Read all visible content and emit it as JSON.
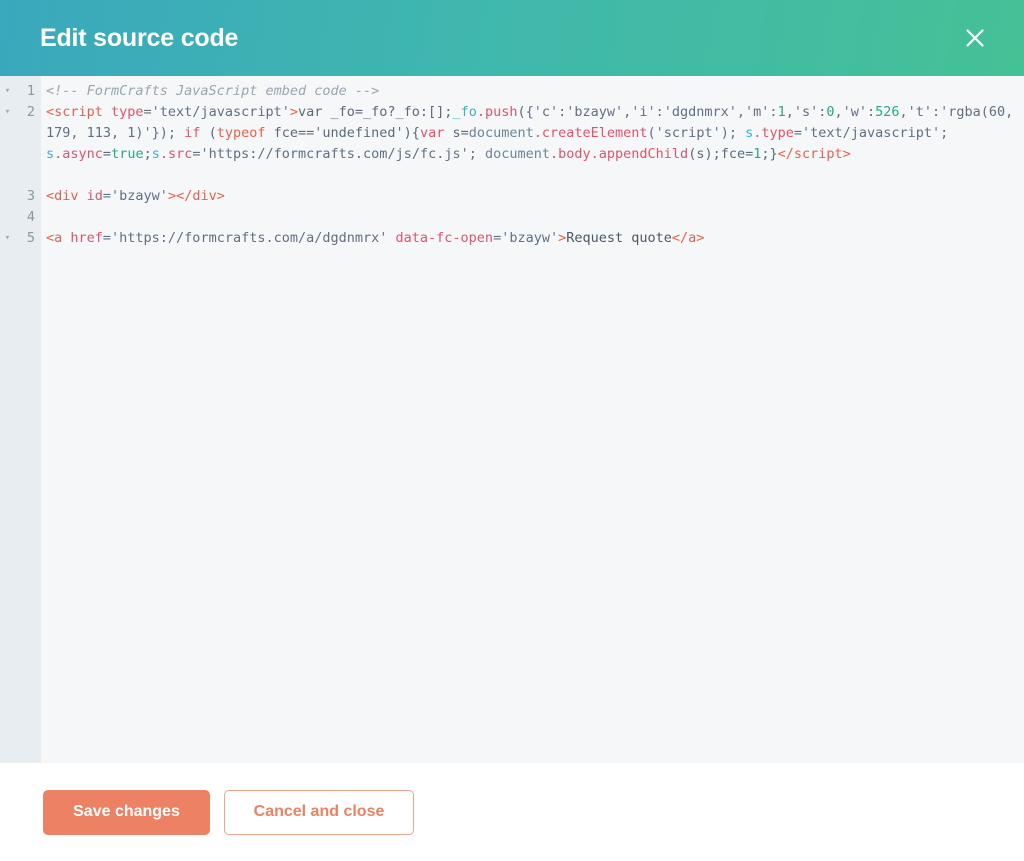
{
  "header": {
    "title": "Edit source code",
    "close_icon": "close-icon",
    "gradient_start": "#3aa8bd",
    "gradient_end": "#45c196"
  },
  "editor": {
    "gutter_bg": "#e8edf1",
    "code_bg": "#f5f7f9",
    "fold_arrow_glyph": "▾",
    "lines": [
      {
        "number": "1",
        "foldable": true
      },
      {
        "number": "2",
        "foldable": true
      },
      {
        "number": "3",
        "foldable": false
      },
      {
        "number": "4",
        "foldable": false
      },
      {
        "number": "5",
        "foldable": true
      }
    ],
    "code": {
      "line1": {
        "comment": "<!-- FormCrafts JavaScript embed code -->"
      },
      "line2": {
        "seg_tag_open": "<script",
        "seg_attr_type": " type",
        "seg_attr_val": "='text/javascript'",
        "seg_gt": ">",
        "seg_var_decl": "var _fo=_fo?_fo:",
        "seg_empty_arr": "[];",
        "seg_fo": "_fo",
        "seg_dot_push": ".push",
        "seg_push_args_a": "({'c':'bzayw','i':'dgdnmrx','m':",
        "seg_num_m": "1",
        "seg_comma_s": ",'s':",
        "seg_num_s": "0",
        "seg_comma_w": ",'w':",
        "seg_num_w": "526",
        "seg_rgba": ",'t':'rgba(60, 179, 113, 1)'});",
        "seg_if": " if",
        "seg_paren_open": " (",
        "seg_typeof": "typeof",
        "seg_fce_undef": " fce=='undefined')",
        "seg_brace_var": "{",
        "seg_var_kw": "var",
        "seg_s_eq": " s=",
        "seg_document": "document",
        "seg_dot_create": ".createElement",
        "seg_script_str": "('script');",
        "seg_s2": " s",
        "seg_dot_type": ".type",
        "seg_type_val": "='text/javascript';",
        "seg_s3": " s",
        "seg_dot_async": ".async",
        "seg_async_val": "=",
        "seg_true": "true",
        "seg_semi1": ";",
        "seg_s4": "s",
        "seg_dot_src": ".src",
        "seg_src_val": "='https://formcrafts.com/js/fc.js';",
        "seg_document2": " document",
        "seg_dot_body": ".body",
        "seg_dot_append": ".appendChild",
        "seg_append_args": "(s);fce=",
        "seg_num_1": "1",
        "seg_close_brace": ";}",
        "seg_tag_close": "</script>"
      },
      "line3": {
        "tag_open": "<div",
        "attr": " id",
        "attr_val": "='bzayw'",
        "gt": ">",
        "tag_close": "</div>"
      },
      "line4": {
        "empty": ""
      },
      "line5": {
        "tag_open": "<a",
        "attr_href": " href",
        "href_val": "='https://formcrafts.com/a/dgdnmrx'",
        "attr_data": " data-fc-open",
        "data_val": "='bzayw'",
        "gt": ">",
        "link_text": "Request quote",
        "tag_close": "</a>"
      }
    }
  },
  "footer": {
    "save_label": "Save changes",
    "cancel_label": "Cancel and close",
    "accent_color": "#ec8163"
  }
}
